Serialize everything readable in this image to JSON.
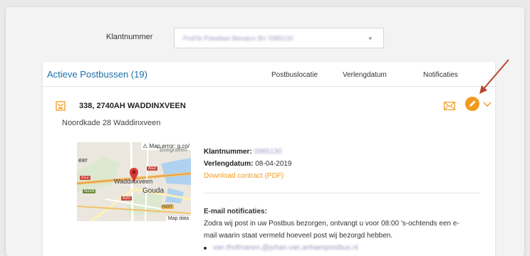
{
  "filter": {
    "label": "Klantnummer",
    "selected_value": "ProFib Poketkan Benatun BV 0985130"
  },
  "panel": {
    "title": "Actieve Postbussen (19)",
    "columns": [
      "Postbuslocatie",
      "Verlengdatum",
      "Notificaties"
    ]
  },
  "mailbox": {
    "address": "338, 2740AH WADDINXVEEN",
    "street": "Noordkade 28 Waddinxveen",
    "map": {
      "error": "Map error: g.co/",
      "town": "Waddinxveen",
      "city": "Gouda",
      "area": "eer",
      "data": "Map data",
      "roads": [
        "A12",
        "A12",
        "N219",
        "A20",
        "N207"
      ],
      "top_fragment": "Boegraven"
    },
    "klantnummer_label": "Klantnummer:",
    "klantnummer_value": "0985130",
    "verlengdatum_label": "Verlengdatum:",
    "verlengdatum_value": "08-04-2019",
    "download_label": "Download contract (PDF)",
    "notif_heading": "E-mail notificaties:",
    "notif_text_1": "Zodra wij post in uw Postbus bezorgen, ontvangt u voor 08:00 's-ochtends een e-",
    "notif_text_2": "mail waarin staat vermeld hoeveel post wij bezorgd hebben.",
    "notif_email": "van.thofmanen,@johan.van.anhaespostbus.nl"
  },
  "colors": {
    "accent": "#f29a1d",
    "title_blue": "#1c6fa8",
    "annotation_arrow": "#b5452f"
  }
}
